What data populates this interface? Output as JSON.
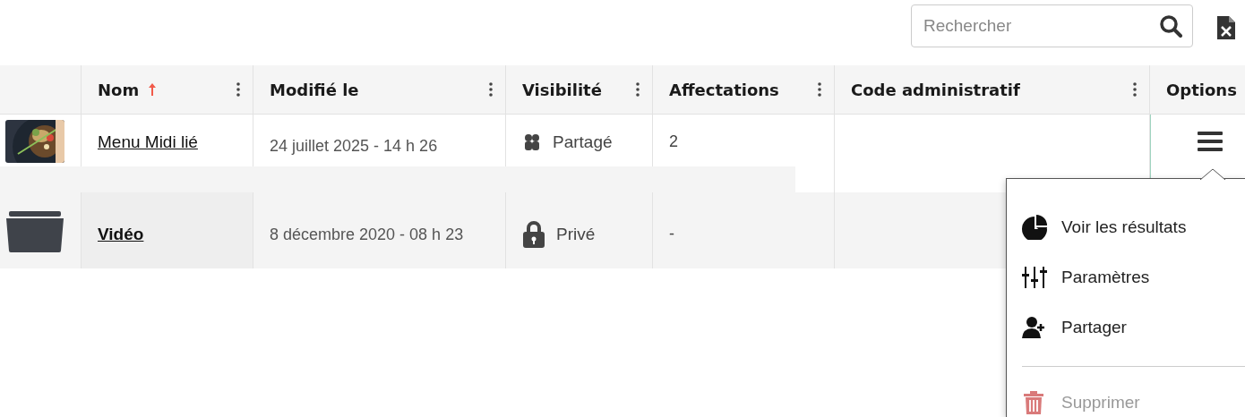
{
  "toolbar": {
    "search": {
      "placeholder": "Rechercher"
    }
  },
  "table": {
    "columns": [
      {
        "kind": "thumb",
        "sorted": false,
        "menu": false
      },
      {
        "kind": "text",
        "label": "Nom",
        "sorted": true,
        "menu": true
      },
      {
        "kind": "text",
        "label": "Modifié le",
        "sorted": false,
        "menu": true
      },
      {
        "kind": "text",
        "label": "Visibilité",
        "sorted": false,
        "menu": true
      },
      {
        "kind": "text",
        "label": "Affectations",
        "sorted": false,
        "menu": true
      },
      {
        "kind": "text",
        "label": "Code administratif",
        "sorted": false,
        "menu": true
      },
      {
        "kind": "text",
        "label": "Options",
        "sorted": false,
        "menu": false
      }
    ],
    "rows": [
      {
        "kind": "picture",
        "name": "Menu Midi lié",
        "name_bold": false,
        "modified": "24 juillet 2025 - 14 h 26",
        "visibility": {
          "kind": "shared",
          "label": "Partagé"
        },
        "assignments": "2",
        "menu_open": true
      },
      {
        "kind": "folder",
        "name": "Vidéo",
        "name_bold": true,
        "modified": "8 décembre 2020 - 08 h 23",
        "visibility": {
          "kind": "private",
          "label": "Privé"
        },
        "assignments": "-",
        "menu_open": false
      }
    ]
  },
  "options_menu": {
    "items": [
      {
        "kind": "results",
        "label": "Voir les résultats",
        "disabled": false
      },
      {
        "kind": "settings",
        "label": "Paramètres",
        "disabled": false
      },
      {
        "kind": "share",
        "label": "Partager",
        "disabled": false
      },
      {
        "kind": "divider"
      },
      {
        "kind": "delete",
        "label": "Supprimer",
        "disabled": true
      }
    ]
  }
}
